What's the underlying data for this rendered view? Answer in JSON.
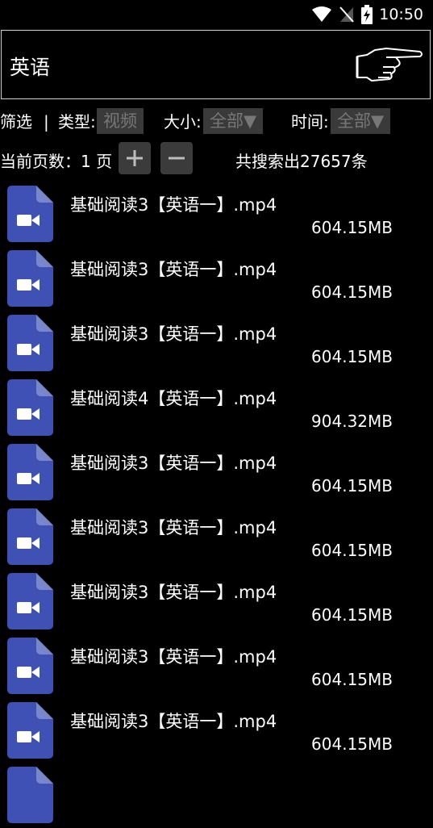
{
  "status": {
    "time": "10:50"
  },
  "search": {
    "query": "英语"
  },
  "filters": {
    "label": "筛选",
    "separator": "|",
    "type_label": "类型:",
    "type_value": "视频",
    "size_label": "大小:",
    "size_value": "全部▼",
    "time_label": "时间:",
    "time_value": "全部▼"
  },
  "pager": {
    "current_label": "当前页数：1 页",
    "plus": "+",
    "minus": "−",
    "total": "共搜索出27657条"
  },
  "files": [
    {
      "name": "基础阅读3【英语一】.mp4",
      "size": "604.15MB"
    },
    {
      "name": "基础阅读3【英语一】.mp4",
      "size": "604.15MB"
    },
    {
      "name": "基础阅读3【英语一】.mp4",
      "size": "604.15MB"
    },
    {
      "name": "基础阅读4【英语一】.mp4",
      "size": "904.32MB"
    },
    {
      "name": "基础阅读3【英语一】.mp4",
      "size": "604.15MB"
    },
    {
      "name": "基础阅读3【英语一】.mp4",
      "size": "604.15MB"
    },
    {
      "name": "基础阅读3【英语一】.mp4",
      "size": "604.15MB"
    },
    {
      "name": "基础阅读3【英语一】.mp4",
      "size": "604.15MB"
    },
    {
      "name": "基础阅读3【英语一】.mp4",
      "size": "604.15MB"
    }
  ],
  "colors": {
    "file_icon": "#3f51b5",
    "file_icon_fold": "#7986cb",
    "chip_bg": "#3a3a3a"
  },
  "icons": {
    "file": "video-file-icon",
    "go": "pointing-hand-icon"
  }
}
